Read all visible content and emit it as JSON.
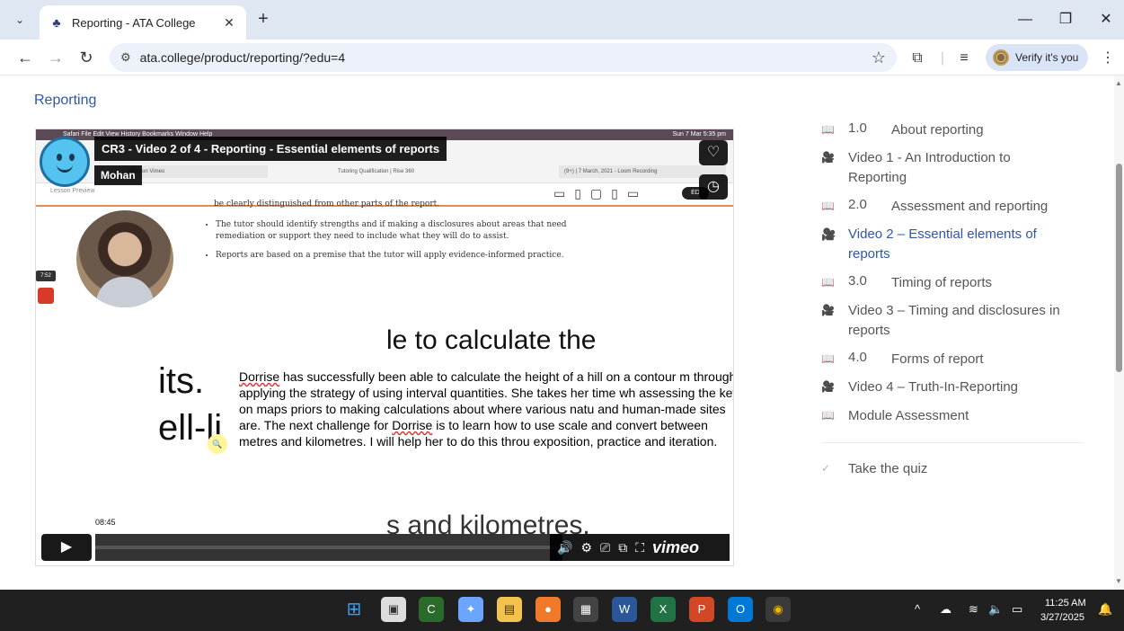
{
  "browser": {
    "tab_title": "Reporting - ATA College",
    "tab_close": "✕",
    "new_tab": "+",
    "url": "ata.college/product/reporting/?edu=4",
    "verify_label": "Verify it's you",
    "window_controls": {
      "minimize": "—",
      "restore": "❐",
      "close": "✕"
    }
  },
  "page": {
    "title": "Reporting"
  },
  "video": {
    "title": "CR3 - Video 2 of 4 - Reporting - Essential elements of reports",
    "author": "Mohan",
    "lesson_preview": "Lesson Preview",
    "mac_menu": "Safari   File   Edit   View   History   Bookmarks   Window   Help",
    "mac_clock": "Sun 7 Mar  5:35 pm",
    "inner_tabs": [
      "ideos on Vimeo",
      "Tutoring Qualification | Rise 360",
      "(9+) | 7 March, 2021 - Loom Recording"
    ],
    "ed_label": "ED",
    "cut_line": "be clearly distinguished from other parts of the report.",
    "bullets": [
      "The tutor should identify strengths and if making a disclosures about areas that need remediation or support they need to include what they will do to assist.",
      "Reports are based on a premise that the tutor will apply evidence-informed practice."
    ],
    "rec_time": "7:52",
    "big_line1": "le to calculate the",
    "big_left1": "its.",
    "big_left2": "ell-li",
    "big_bottom": "s and kilometres.",
    "desc_word1": "Dorrise",
    "desc_part1": " has successfully been able to calculate the height of a hill on a contour m through applying the strategy of using interval quantities. She takes her time wh assessing the key on maps priors to making calculations about where various natu and human-made sites are. The next challenge for ",
    "desc_word2": "Dorrise",
    "desc_part2": " is to learn how to use scale and convert between metres and kilometres. I will help her to do this throu exposition, practice and iteration.",
    "time_tip": "08:45",
    "progress_fraction": 0.0,
    "vimeo": "vimeo"
  },
  "toc": {
    "items": [
      {
        "icon": "book-icon",
        "num": "1.0",
        "label": "About reporting",
        "active": false
      },
      {
        "icon": "video-icon",
        "num": "",
        "label": "Video 1 - An Introduction to Reporting",
        "active": false
      },
      {
        "icon": "book-icon",
        "num": "2.0",
        "label": "Assessment and reporting",
        "active": false
      },
      {
        "icon": "video-icon",
        "num": "",
        "label": "Video 2 – Essential elements of reports",
        "active": true
      },
      {
        "icon": "book-icon",
        "num": "3.0",
        "label": "Timing of reports",
        "active": false
      },
      {
        "icon": "video-icon",
        "num": "",
        "label": "Video 3 – Timing and disclosures in reports",
        "active": false
      },
      {
        "icon": "book-icon",
        "num": "4.0",
        "label": "Forms of report",
        "active": false
      },
      {
        "icon": "video-icon",
        "num": "",
        "label": "Video 4 – Truth-In-Reporting",
        "active": false
      },
      {
        "icon": "book-icon",
        "num": "",
        "label": "Module Assessment",
        "active": false
      }
    ],
    "quiz_label": "Take the quiz"
  },
  "taskbar": {
    "time": "11:25 AM",
    "date": "3/27/2025"
  },
  "colors": {
    "accent": "#2f57a6",
    "chrome_bg": "#dfe7f3"
  }
}
